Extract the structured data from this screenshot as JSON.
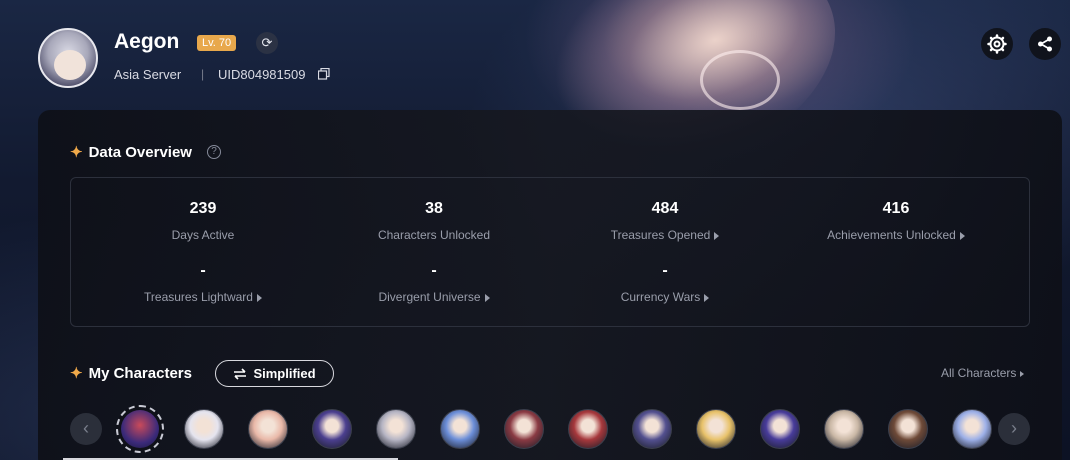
{
  "profile": {
    "name": "Aegon",
    "level": "Lv. 70",
    "server": "Asia Server",
    "separator": "|",
    "uid": "UID804981509"
  },
  "data_overview": {
    "title": "Data Overview",
    "help": "?",
    "stats": [
      {
        "value": "239",
        "label": "Days Active",
        "has_arrow": false
      },
      {
        "value": "38",
        "label": "Characters Unlocked",
        "has_arrow": false
      },
      {
        "value": "484",
        "label": "Treasures Opened",
        "has_arrow": true
      },
      {
        "value": "416",
        "label": "Achievements Unlocked",
        "has_arrow": true
      },
      {
        "value": "-",
        "label": "Treasures Lightward",
        "has_arrow": true
      },
      {
        "value": "-",
        "label": "Divergent Universe",
        "has_arrow": true
      },
      {
        "value": "-",
        "label": "Currency Wars",
        "has_arrow": true
      }
    ]
  },
  "my_characters": {
    "title": "My Characters",
    "toggle_label": "Simplified",
    "toggle_icon": "swap-icon",
    "all_link": "All Characters",
    "characters": [
      {
        "color": "#c94a5a",
        "selected": true
      },
      {
        "color": "#e5e4ef"
      },
      {
        "color": "#e9b8a8"
      },
      {
        "color": "#4b3f8f"
      },
      {
        "color": "#b6b5c4"
      },
      {
        "color": "#6c8ed8"
      },
      {
        "color": "#8a3a43"
      },
      {
        "color": "#a6383c"
      },
      {
        "color": "#53508f"
      },
      {
        "color": "#e8c26a"
      },
      {
        "color": "#483c9a"
      },
      {
        "color": "#c9b7a5"
      },
      {
        "color": "#6e4a38"
      },
      {
        "color": "#9db0e8"
      }
    ]
  },
  "colors": {
    "accent": "#f0a94a",
    "level_badge": "#e8a84c"
  }
}
